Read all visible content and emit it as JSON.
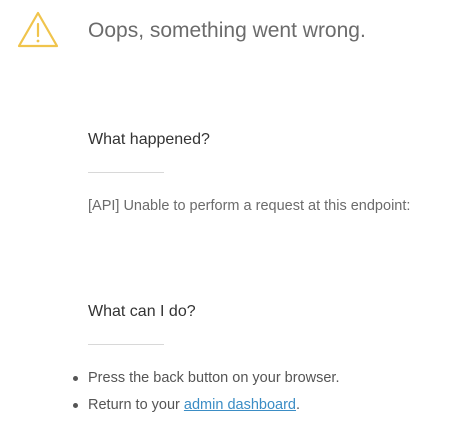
{
  "header": {
    "icon": "warning-icon",
    "icon_color": "#f0c44c",
    "title": "Oops, something went wrong."
  },
  "what_happened": {
    "heading": "What happened?",
    "message": "[API] Unable to perform a request at this endpoint:"
  },
  "what_can_i_do": {
    "heading": "What can I do?",
    "items": [
      {
        "text": "Press the back button on your browser."
      },
      {
        "text_before": "Return to your ",
        "link_text": "admin dashboard",
        "text_after": "."
      }
    ]
  },
  "colors": {
    "link": "#3b8dc5",
    "title": "#6b6b6b",
    "divider": "#d8d8d8"
  }
}
